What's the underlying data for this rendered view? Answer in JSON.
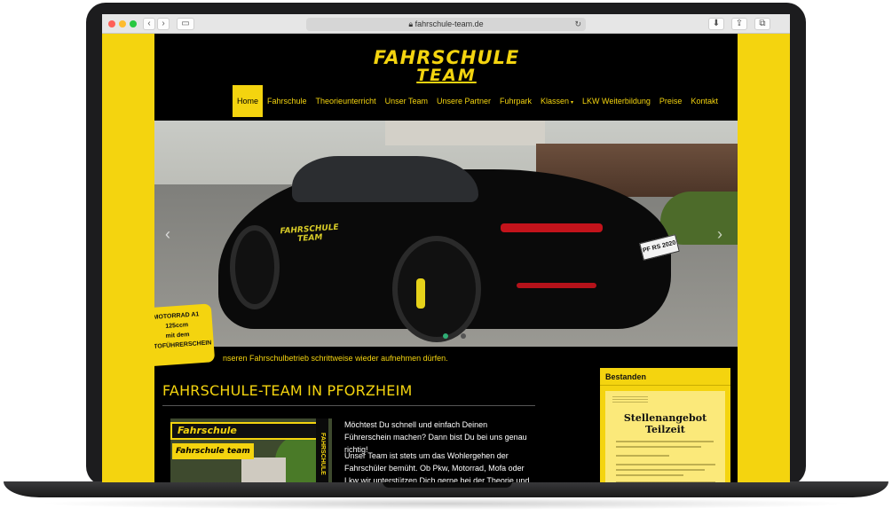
{
  "browser": {
    "url": "fahrschule-team.de",
    "back_icon": "‹",
    "forward_icon": "›",
    "reload_icon": "↻",
    "download_icon": "⬇",
    "share_icon": "⇪",
    "tabs_icon": "⧉"
  },
  "site": {
    "logo_line1": "FAHRSCHULE",
    "logo_line2": "TEAM",
    "nav": [
      {
        "label": "Home",
        "active": true
      },
      {
        "label": "Fahrschule"
      },
      {
        "label": "Theorieunterricht"
      },
      {
        "label": "Unser Team"
      },
      {
        "label": "Unsere Partner"
      },
      {
        "label": "Fuhrpark"
      },
      {
        "label": "Klassen"
      },
      {
        "label": "LKW Weiterbildung"
      },
      {
        "label": "Preise"
      },
      {
        "label": "Kontakt"
      }
    ],
    "nav_caret": "▾"
  },
  "hero": {
    "door_logo_line1": "FAHRSCHULE",
    "door_logo_line2": "TEAM",
    "plate": "PF RS 2020",
    "prev_arrow": "‹",
    "next_arrow": "›",
    "slide_count": 2,
    "active_slide": 1
  },
  "ticker": {
    "text": "nseren Fahrschulbetrieb schrittweise wieder aufnehmen dürfen."
  },
  "badge": {
    "line1": "MOTORRAD A1",
    "line2": "125ccm",
    "line3": "mit dem",
    "line4": "AUTOFÜHRERSCHEIN"
  },
  "content": {
    "heading": "FAHRSCHULE-TEAM IN PFORZHEIM",
    "photo_sign": "Fahrschule",
    "photo_sign2": "Fahrschule team",
    "photo_band": "FAHRSCHULE",
    "paragraph1": "Möchtest Du schnell und einfach Deinen Führerschein machen? Dann bist Du bei uns genau richtig!",
    "paragraph2": "Unser Team ist stets um das Wohlergehen der Fahrschüler bemüht. Ob Pkw, Motorrad, Mofa oder Lkw wir unterstützen Dich gerne bei der Theorie und Praxis. Wir freuen uns auf Dein"
  },
  "sidebar": {
    "title": "Bestanden",
    "flyer_title1": "Stellenangebot",
    "flyer_title2": "Teilzeit"
  },
  "colors": {
    "brand_yellow": "#f4d40f",
    "page_black": "#000000"
  }
}
